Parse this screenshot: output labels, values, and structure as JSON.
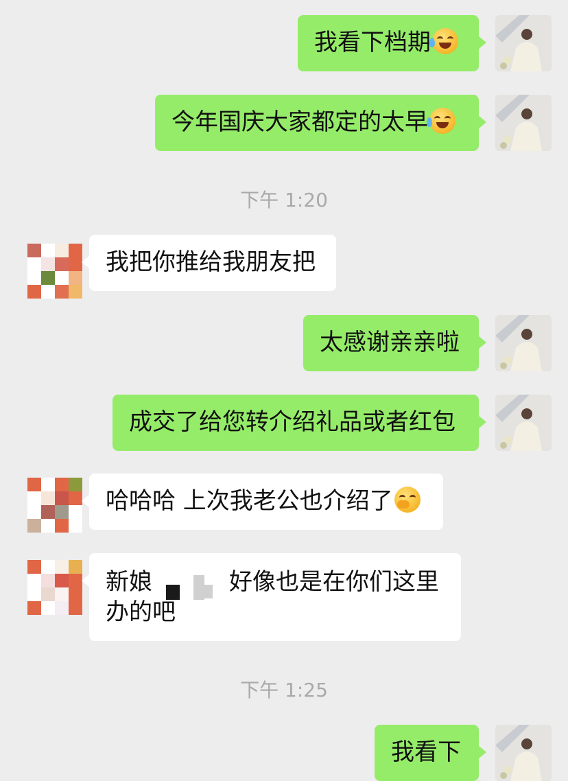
{
  "messages": [
    {
      "side": "me",
      "text": "我看下档期",
      "emoji": "face-with-tears-of-joy"
    },
    {
      "side": "me",
      "text": "今年国庆大家都定的太早",
      "emoji": "face-with-tears-of-joy"
    },
    {
      "type": "time",
      "text": "下午 1:20"
    },
    {
      "side": "peer",
      "text": "我把你推给我朋友把"
    },
    {
      "side": "me",
      "text": "太感谢亲亲啦"
    },
    {
      "side": "me",
      "text": "成交了给您转介绍礼品或者红包"
    },
    {
      "side": "peer",
      "text": "哈哈哈 上次我老公也介绍了",
      "emoji": "face-with-hand-over-mouth"
    },
    {
      "side": "peer",
      "line1_start": "新娘",
      "line1_end": "好像也是在你们这里",
      "line2": "办的吧"
    },
    {
      "type": "time",
      "text": "下午 1:25"
    },
    {
      "side": "me",
      "text": "我看下"
    }
  ],
  "colors": {
    "background": "#ededed",
    "my_bubble": "#95ec69",
    "peer_bubble": "#ffffff",
    "timestamp": "#a9a9a9"
  }
}
